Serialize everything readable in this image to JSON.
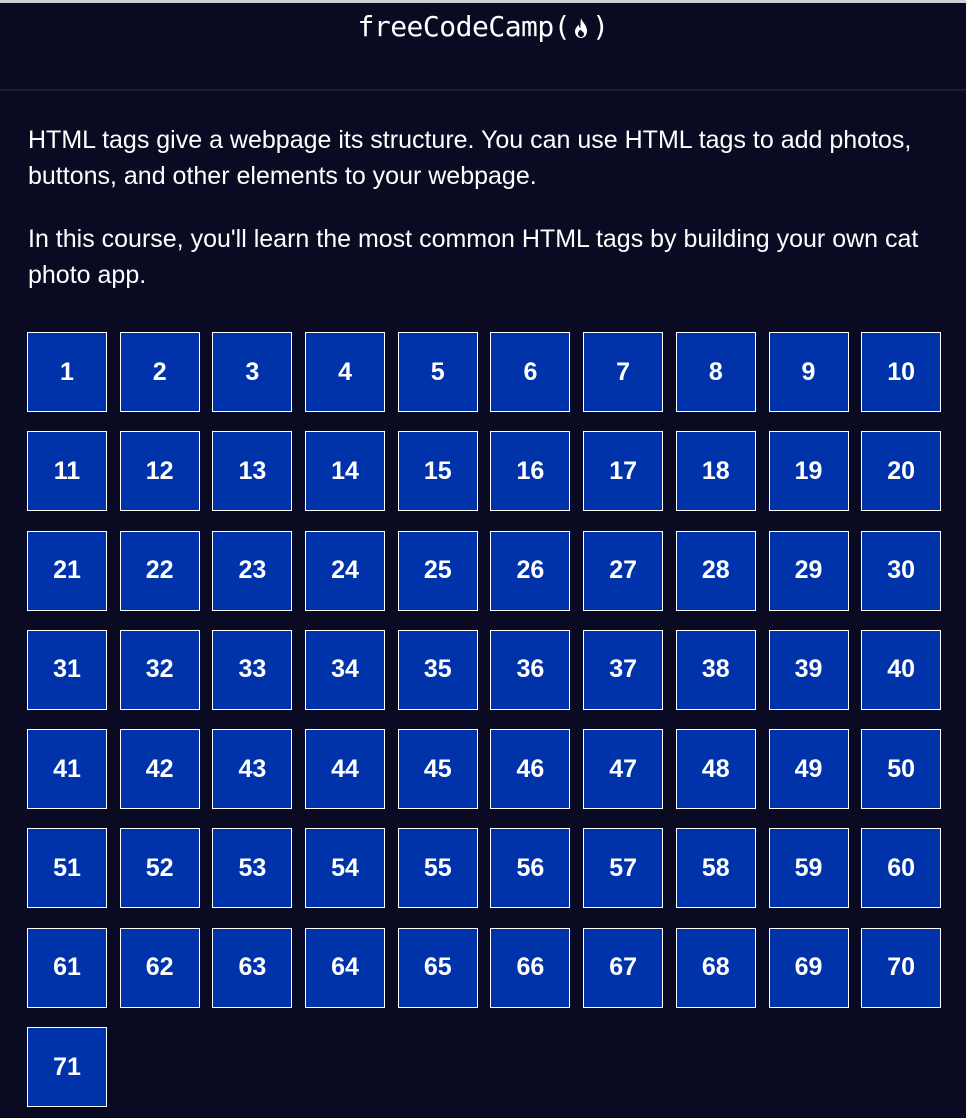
{
  "header": {
    "logo_text_before": "freeCodeCamp(",
    "logo_text_after": ")",
    "logo_icon": "fire-icon"
  },
  "intro": {
    "paragraph_1": "HTML tags give a webpage its structure. You can use HTML tags to add photos, buttons, and other elements to your webpage.",
    "paragraph_2": "In this course, you'll learn the most common HTML tags by building your own cat photo app."
  },
  "steps": [
    "1",
    "2",
    "3",
    "4",
    "5",
    "6",
    "7",
    "8",
    "9",
    "10",
    "11",
    "12",
    "13",
    "14",
    "15",
    "16",
    "17",
    "18",
    "19",
    "20",
    "21",
    "22",
    "23",
    "24",
    "25",
    "26",
    "27",
    "28",
    "29",
    "30",
    "31",
    "32",
    "33",
    "34",
    "35",
    "36",
    "37",
    "38",
    "39",
    "40",
    "41",
    "42",
    "43",
    "44",
    "45",
    "46",
    "47",
    "48",
    "49",
    "50",
    "51",
    "52",
    "53",
    "54",
    "55",
    "56",
    "57",
    "58",
    "59",
    "60",
    "61",
    "62",
    "63",
    "64",
    "65",
    "66",
    "67",
    "68",
    "69",
    "70",
    "71"
  ],
  "colors": {
    "background": "#0a0a23",
    "step_button": "#0033aa",
    "text": "#ffffff"
  }
}
